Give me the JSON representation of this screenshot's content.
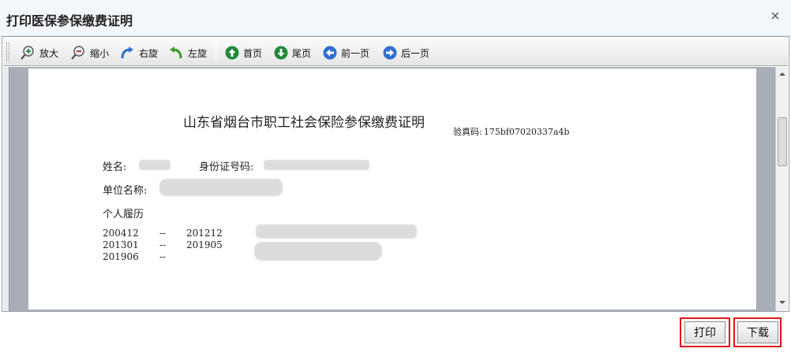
{
  "dialog": {
    "title": "打印医保参保缴费证明"
  },
  "toolbar": {
    "zoom_in": "放大",
    "zoom_out": "缩小",
    "rotate_right": "右旋",
    "rotate_left": "左旋",
    "first_page": "首页",
    "last_page": "尾页",
    "prev_page": "前一页",
    "next_page": "后一页"
  },
  "document": {
    "title": "山东省烟台市职工社会保险参保缴费证明",
    "verify_label": "验真码:",
    "verify_code": "175bf07020337a4b",
    "name_label": "姓名:",
    "id_label": "身份证号码:",
    "employer_label": "单位名称:",
    "history_label": "个人履历",
    "history": [
      {
        "start": "200412",
        "sep": "--",
        "end": "201212"
      },
      {
        "start": "201301",
        "sep": "--",
        "end": "201905"
      },
      {
        "start": "201906",
        "sep": "--",
        "end": ""
      }
    ]
  },
  "footer": {
    "print_label": "打印",
    "download_label": "下载"
  },
  "colors": {
    "highlight": "#e0161b",
    "toolbar_icon_green": "#1f8a3a",
    "toolbar_icon_blue": "#2f6fd1"
  }
}
